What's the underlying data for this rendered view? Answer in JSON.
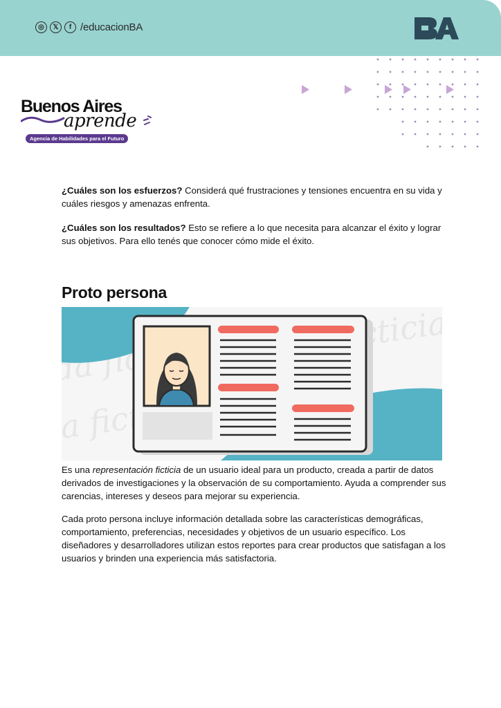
{
  "header": {
    "social_handle": "/educacionBA",
    "social_icons": [
      {
        "name": "instagram",
        "glyph": "◎"
      },
      {
        "name": "x-twitter",
        "glyph": "𝕏"
      },
      {
        "name": "facebook",
        "glyph": "f"
      }
    ],
    "brand_logo_text": "BA",
    "colors": {
      "band": "#98d3cf",
      "logo": "#2c4a5a"
    }
  },
  "logo": {
    "title": "Buenos Aires",
    "script": "aprende",
    "tagline": "Agencia de Habilidades para el Futuro",
    "colors": {
      "accent": "#5b3a8e"
    }
  },
  "content": {
    "p1_bold": "¿Cuáles son los esfuerzos?",
    "p1_text": " Considerá qué frustraciones y tensiones encuentra en su vida y cuáles riesgos y amenazas enfrenta.",
    "p2_bold": "¿Cuáles son los resultados?",
    "p2_text": " Esto se refiere a lo que necesita para alcanzar el éxito y lograr sus objetivos. Para ello tenés que conocer cómo mide el éxito.",
    "section_title": "Proto persona",
    "p3_a": "Es una ",
    "p3_em": "representación ficticia",
    "p3_b": " de un usuario ideal para un producto, creada a partir de datos derivados de investigaciones y la observación de su comportamiento. Ayuda a comprender sus carencias, intereses y deseos para mejorar su experiencia.",
    "p4": "Cada proto persona incluye información detallada sobre las características demográficas, comportamiento, preferencias, necesidades y objetivos de un usuario específico. Los diseñadores y desarrolladores utilizan estos reportes para crear productos que satisfagan a los usuarios y brinden una experiencia más satisfactoria."
  },
  "illustration": {
    "watermark_text": "da ficticia",
    "colors": {
      "teal": "#56b3c6",
      "card": "#f5f5f5",
      "red_bar": "#f06a5f",
      "line": "#2b2b2b",
      "photo_bg": "#fce6c8",
      "shirt": "#3f8bb0"
    }
  },
  "decor": {
    "arrow_color": "#c8a6d6",
    "dot_color": "#a28bb6"
  }
}
